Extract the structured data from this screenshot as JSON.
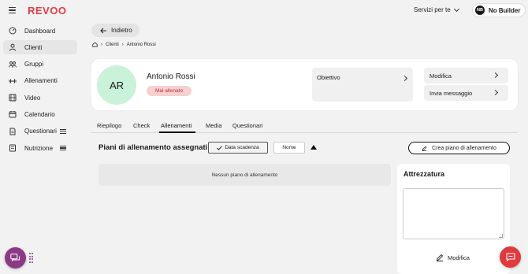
{
  "app": {
    "logo": "REVOO",
    "accent": "#e53945"
  },
  "header": {
    "services_label": "Servizi per te",
    "user_initials": "NB",
    "user_name": "No Builder"
  },
  "sidebar": {
    "items": [
      {
        "label": "Dashboard",
        "icon": "gauge-icon",
        "active": false
      },
      {
        "label": "Clienti",
        "icon": "user-icon",
        "active": true
      },
      {
        "label": "Gruppi",
        "icon": "group-icon",
        "active": false
      },
      {
        "label": "Allenamenti",
        "icon": "dumbbell-icon",
        "active": false
      },
      {
        "label": "Video",
        "icon": "film-icon",
        "active": false
      },
      {
        "label": "Calendario",
        "icon": "calendar-icon",
        "active": false
      },
      {
        "label": "Questionari",
        "icon": "document-icon",
        "active": false
      },
      {
        "label": "Nutrizione",
        "icon": "book-icon",
        "active": false
      }
    ]
  },
  "back_button": {
    "label": "Indietro"
  },
  "breadcrumb": {
    "items": [
      "Clienti",
      "Antonio Rossi"
    ]
  },
  "profile": {
    "initials": "AR",
    "name": "Antonio Rossi",
    "status": "Mai allenato",
    "objective_label": "Obiettivo",
    "edit_label": "Modifica",
    "message_label": "Invia messaggio"
  },
  "tabs": {
    "items": [
      "Riepilogo",
      "Check",
      "Allenamenti",
      "Media",
      "Questionari"
    ],
    "active": "Allenamenti"
  },
  "plans": {
    "title": "Piani di allenamento assegnati",
    "sort_date": "Data scadenza",
    "sort_name": "Nome",
    "create_label": "Crea piano di allenamento",
    "empty_text": "Nessun piano di allenamento"
  },
  "equipment": {
    "title": "Attrezzatura",
    "value": "",
    "edit_label": "Modifica"
  }
}
